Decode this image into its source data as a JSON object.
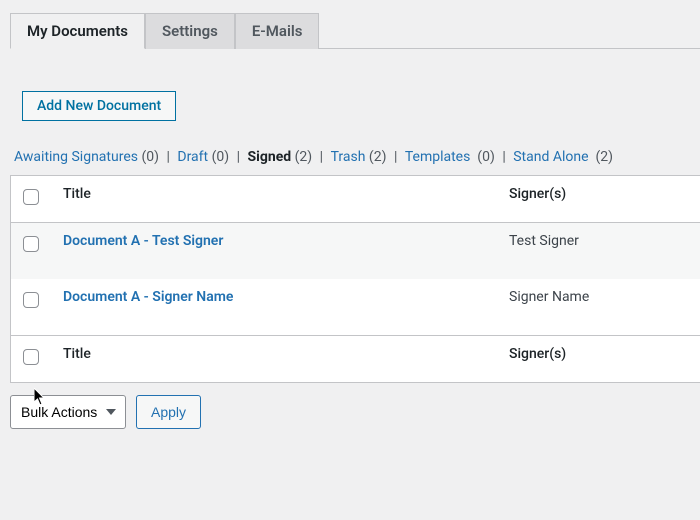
{
  "tabs": [
    {
      "label": "My Documents",
      "active": true
    },
    {
      "label": "Settings",
      "active": false
    },
    {
      "label": "E-Mails",
      "active": false
    }
  ],
  "add_button": "Add New Document",
  "filters": [
    {
      "label": "Awaiting Signatures",
      "count": "(0)",
      "current": false,
      "trailing_sep": true
    },
    {
      "label": "Draft",
      "count": "(0)",
      "current": false,
      "trailing_sep": true
    },
    {
      "label": "Signed",
      "count": "(2)",
      "current": true,
      "trailing_sep": true
    },
    {
      "label": "Trash",
      "count": "(2)",
      "current": false,
      "trailing_sep": true
    },
    {
      "label": "Templates",
      "count": "(0)",
      "current": false,
      "trailing_sep": true
    },
    {
      "label": "Stand Alone",
      "count": "(2)",
      "current": false,
      "trailing_sep": false
    }
  ],
  "table": {
    "headers": {
      "title": "Title",
      "signers": "Signer(s)"
    },
    "rows": [
      {
        "title": "Document A - Test Signer",
        "signers": "Test Signer"
      },
      {
        "title": "Document A - Signer Name",
        "signers": "Signer Name"
      }
    ],
    "footer": {
      "title": "Title",
      "signers": "Signer(s)"
    }
  },
  "bulk": {
    "selected": "Bulk Actions",
    "apply": "Apply"
  }
}
